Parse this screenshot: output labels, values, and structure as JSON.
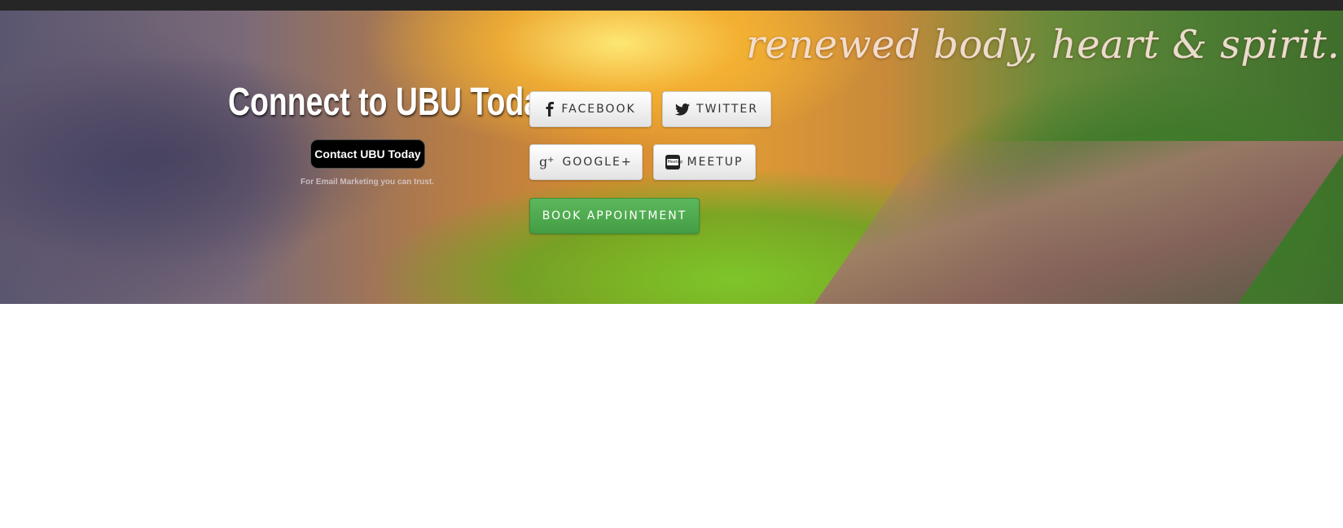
{
  "hero": {
    "tagline": "renewed body, heart & spirit..."
  },
  "connect": {
    "title": "Connect to UBU Today:",
    "contact_button": "Contact UBU Today",
    "trust_text": "For Email Marketing you can trust."
  },
  "social": {
    "facebook": "FACEBOOK",
    "twitter": "TWITTER",
    "google": "GOOGLE+",
    "meetup": "MEETUP",
    "meetup_badge": "Meetup"
  },
  "booking": {
    "button_label": "BOOK APPOINTMENT",
    "color": "#5cb85c"
  },
  "icons": [
    "facebook-icon",
    "twitter-icon",
    "google-plus-icon",
    "meetup-icon"
  ]
}
